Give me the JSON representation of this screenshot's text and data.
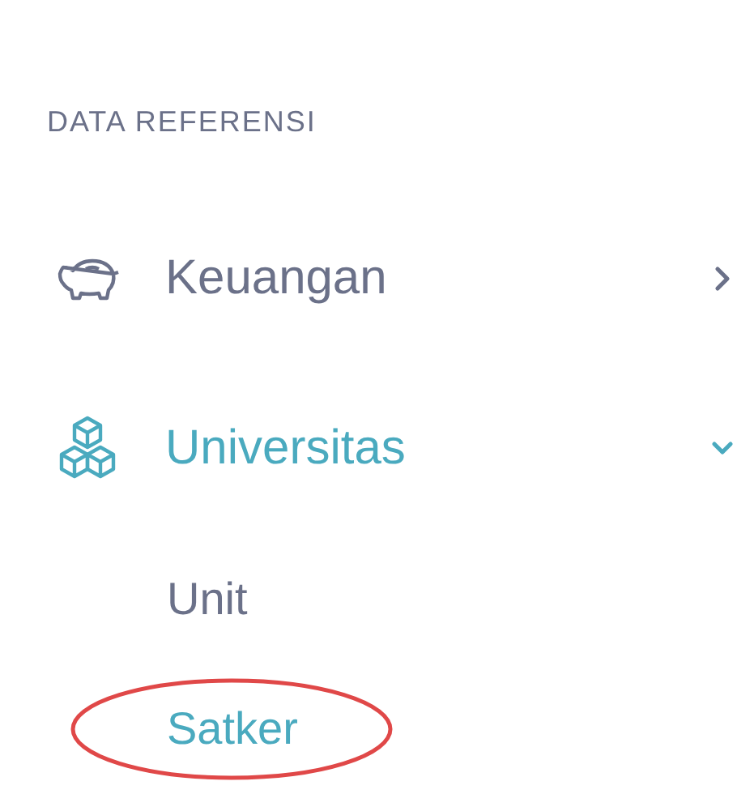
{
  "section_heading": "DATA REFERENSI",
  "menu": [
    {
      "label": "Keuangan",
      "expanded": false,
      "selected": false
    },
    {
      "label": "Universitas",
      "expanded": true,
      "selected": true,
      "children": [
        {
          "label": "Unit",
          "selected": false,
          "circled": false
        },
        {
          "label": "Satker",
          "selected": true,
          "circled": true
        }
      ]
    }
  ]
}
